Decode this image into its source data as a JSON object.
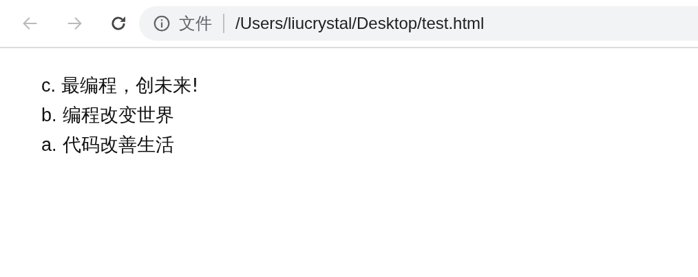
{
  "toolbar": {
    "back": {
      "disabled": true
    },
    "forward": {
      "disabled": true
    }
  },
  "address_bar": {
    "scheme_label": "文件",
    "url": "/Users/liucrystal/Desktop/test.html"
  },
  "list": [
    {
      "marker": "c.",
      "text": "最编程，创未来!"
    },
    {
      "marker": "b.",
      "text": "编程改变世界"
    },
    {
      "marker": "a.",
      "text": "代码改善生活"
    }
  ]
}
